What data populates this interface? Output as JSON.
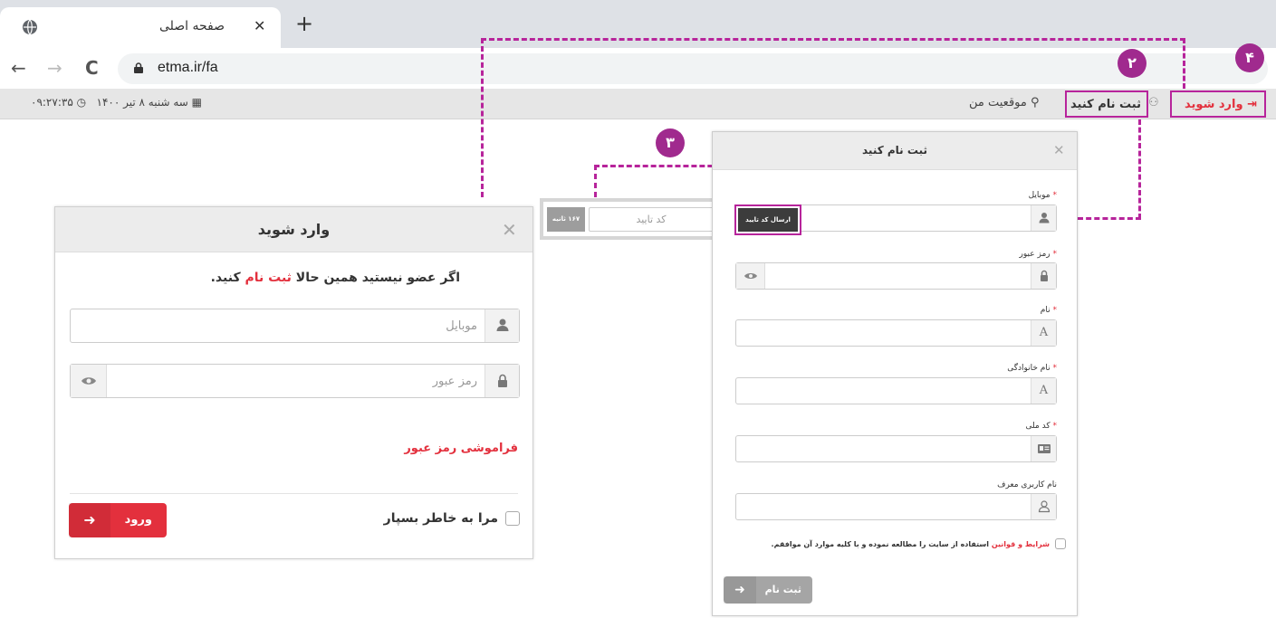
{
  "browser": {
    "tab_title": "صفحه اصلی",
    "tab_close": "✕",
    "new_tab": "+",
    "back": "←",
    "forward": "→",
    "reload": "C",
    "url": "etma.ir/fa"
  },
  "topbar": {
    "login": "وارد شوید",
    "register": "ثبت نام کنید",
    "location": "موقعیت من",
    "date": "سه شنبه ۸ تیر ۱۴۰۰",
    "time": "۰۹:۲۷:۳۵"
  },
  "badges": {
    "b2": "۲",
    "b3": "۳",
    "b4": "۴"
  },
  "login_modal": {
    "title": "وارد شوید",
    "close": "✕",
    "message_prefix": "اگر عضو نیستید همین حالا ",
    "message_link": "ثبت نام",
    "message_suffix": " کنید.",
    "mobile_placeholder": "موبایل",
    "password_placeholder": "رمز عبور",
    "forgot": "فراموشی رمز عبور",
    "remember": "مرا به خاطر بسپار",
    "submit": "ورود"
  },
  "register_modal": {
    "title": "ثبت نام کنید",
    "close": "✕",
    "send_code": "ارسال کد تایید",
    "fields": [
      {
        "label": "موبایل",
        "required": "*"
      },
      {
        "label": "رمز عبور",
        "required": "*"
      },
      {
        "label": "نام",
        "required": "*"
      },
      {
        "label": "نام خانوادگی",
        "required": "*"
      },
      {
        "label": "کد ملی",
        "required": "*"
      },
      {
        "label": "نام کاربری معرف",
        "required": ""
      }
    ],
    "terms_link": "شرایط و قوانین",
    "terms_text": " استفاده از سایت را مطالعه نموده و با کلیه موارد آن موافقم.",
    "submit": "ثبت نام"
  },
  "verify": {
    "placeholder": "کد تایید",
    "timer": "۱۶۷ ثانیه"
  },
  "colors": {
    "accent": "#e3303d",
    "annotation": "#b7249b",
    "badge": "#a02a8e"
  }
}
